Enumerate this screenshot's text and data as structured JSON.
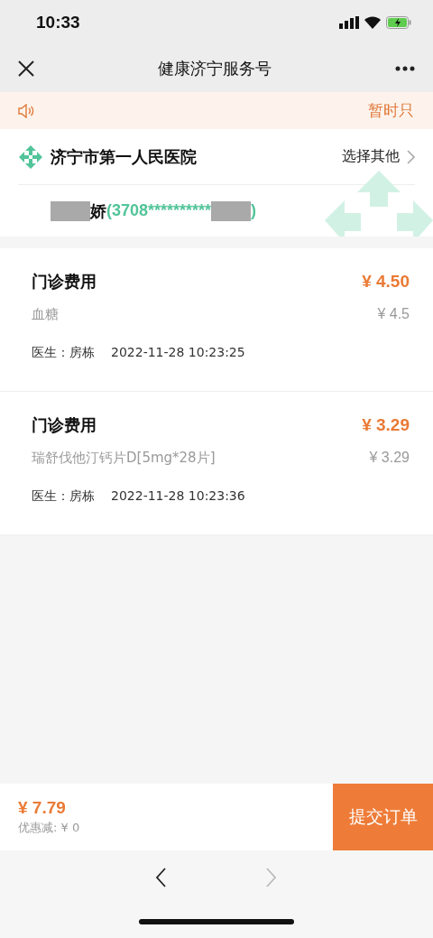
{
  "status_bar": {
    "time": "10:33"
  },
  "nav": {
    "title": "健康济宁服务号"
  },
  "notice": {
    "text": "暂时只"
  },
  "hospital": {
    "name": "济宁市第一人民医院",
    "action": "选择其他"
  },
  "patient": {
    "name": "娇",
    "id_prefix": "(3708**********",
    "id_suffix": ")"
  },
  "items": [
    {
      "category": "门诊费用",
      "total": "¥ 4.50",
      "name": "血糖",
      "price": "¥ 4.5",
      "doctor": "医生：房栋",
      "time": "2022-11-28 10:23:25"
    },
    {
      "category": "门诊费用",
      "total": "¥ 3.29",
      "name": "瑞舒伐他汀钙片D[5mg*28片]",
      "price": "¥ 3.29",
      "doctor": "医生：房栋",
      "time": "2022-11-28 10:23:36"
    }
  ],
  "footer": {
    "total": "¥ 7.79",
    "discount": "优惠减: ¥ 0",
    "submit": "提交订单"
  },
  "browser_nav": [
    {
      "kind": "back",
      "disabled": false
    },
    {
      "kind": "forward",
      "disabled": true
    }
  ]
}
